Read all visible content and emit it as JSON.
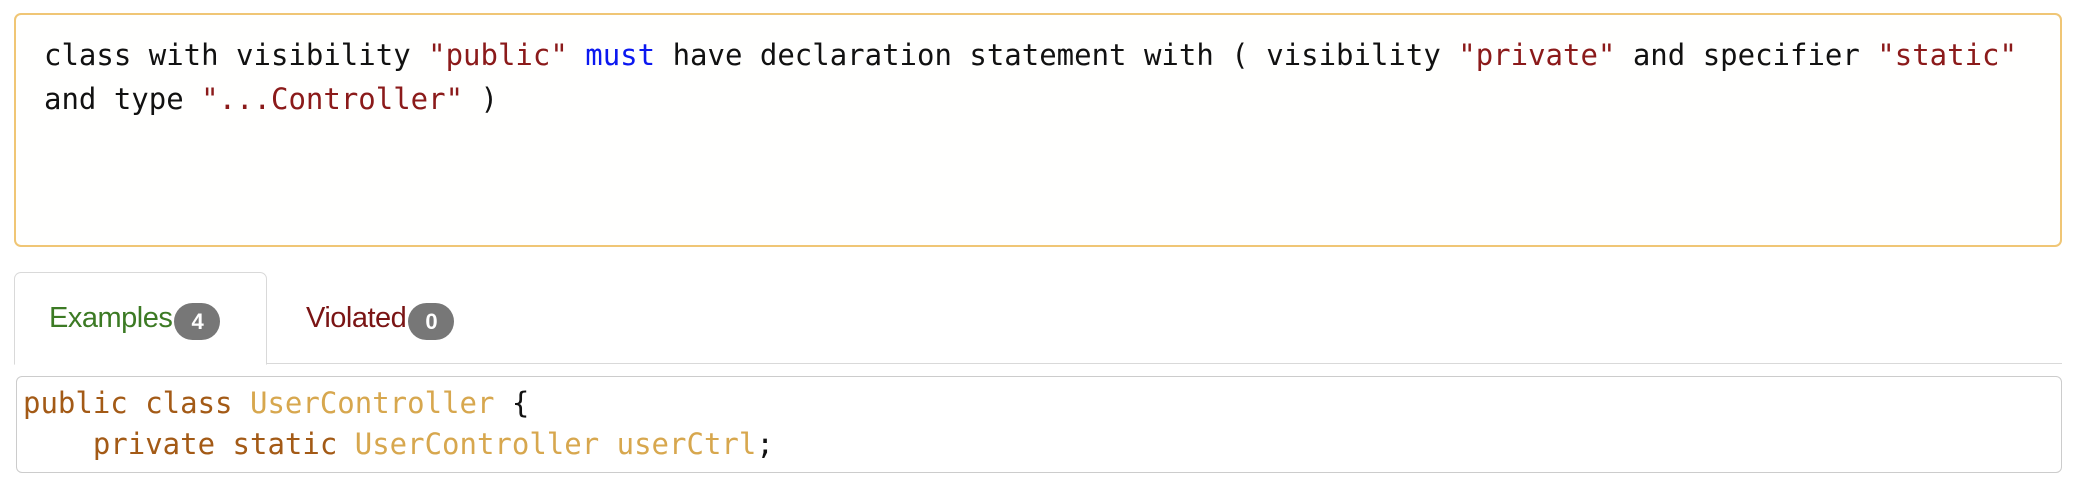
{
  "rule": {
    "line1": [
      {
        "text": "class with visibility ",
        "kind": "plain"
      },
      {
        "text": "\"public\"",
        "kind": "string"
      },
      {
        "text": " ",
        "kind": "plain"
      },
      {
        "text": "must",
        "kind": "keyword"
      },
      {
        "text": " have declaration statement with ( visibility ",
        "kind": "plain"
      },
      {
        "text": "\"private\"",
        "kind": "string"
      },
      {
        "text": " and specifier ",
        "kind": "plain"
      },
      {
        "text": "\"static\"",
        "kind": "string"
      }
    ],
    "line2": [
      {
        "text": "and type ",
        "kind": "plain"
      },
      {
        "text": "\"...Controller\"",
        "kind": "string"
      },
      {
        "text": " )",
        "kind": "plain"
      }
    ]
  },
  "tabs": [
    {
      "label": "Examples",
      "count": "4",
      "active": true
    },
    {
      "label": "Violated",
      "count": "0",
      "active": false
    }
  ],
  "code": {
    "line1": {
      "kw": "public class ",
      "type": "UserController",
      "rest": " {"
    },
    "line2": {
      "indent": "    ",
      "kw": "private static ",
      "type": "UserController userCtrl",
      "rest": ";"
    }
  },
  "colors": {
    "rule_border": "#f0c675",
    "string": "#8b1a1a",
    "keyword": "#0b18f0",
    "tab_examples": "#3c7a24",
    "tab_violated": "#7a1414",
    "badge_bg": "#777777",
    "code_keyword": "#a35a16",
    "code_type": "#d7a74e"
  }
}
